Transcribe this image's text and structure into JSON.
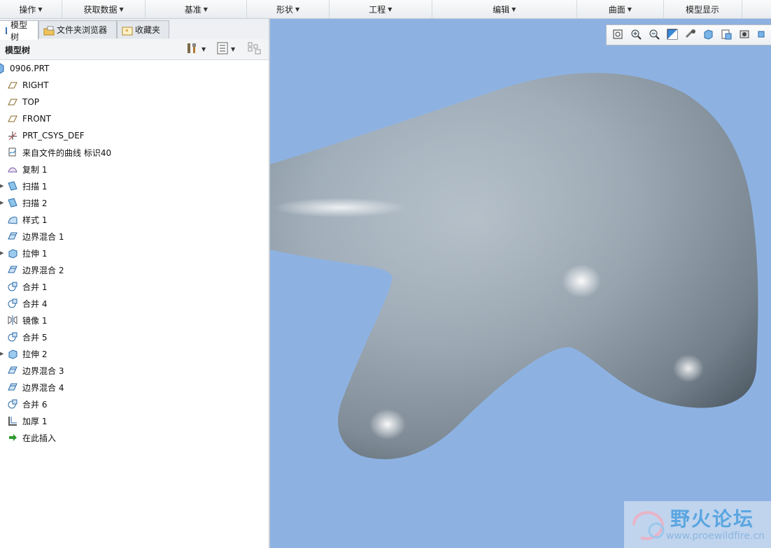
{
  "menubar": {
    "groups": [
      {
        "label": "操作"
      },
      {
        "label": "获取数据"
      },
      {
        "label": "基准"
      },
      {
        "label": "形状"
      },
      {
        "label": "工程"
      },
      {
        "label": "编辑"
      },
      {
        "label": "曲面"
      },
      {
        "label": "模型显示"
      }
    ]
  },
  "tabs": [
    {
      "label": "模型树",
      "icon": "model-tree-icon"
    },
    {
      "label": "文件夹浏览器",
      "icon": "folder-browser-icon"
    },
    {
      "label": "收藏夹",
      "icon": "favorites-icon"
    }
  ],
  "tree_header": {
    "title": "模型树"
  },
  "tree": [
    {
      "label": "0906.PRT",
      "icon": "part-icon",
      "expandable": false
    },
    {
      "label": "RIGHT",
      "icon": "datum-plane-icon",
      "expandable": false
    },
    {
      "label": "TOP",
      "icon": "datum-plane-icon",
      "expandable": false
    },
    {
      "label": "FRONT",
      "icon": "datum-plane-icon",
      "expandable": false
    },
    {
      "label": "PRT_CSYS_DEF",
      "icon": "csys-icon",
      "expandable": false
    },
    {
      "label": "来自文件的曲线 标识40",
      "icon": "curve-from-file-icon",
      "expandable": false
    },
    {
      "label": "复制 1",
      "icon": "copy-surface-icon",
      "expandable": false
    },
    {
      "label": "扫描 1",
      "icon": "sweep-icon",
      "expandable": true
    },
    {
      "label": "扫描 2",
      "icon": "sweep-icon",
      "expandable": true
    },
    {
      "label": "样式 1",
      "icon": "style-icon",
      "expandable": false
    },
    {
      "label": "边界混合 1",
      "icon": "boundary-blend-icon",
      "expandable": false
    },
    {
      "label": "拉伸 1",
      "icon": "extrude-icon",
      "expandable": true
    },
    {
      "label": "边界混合 2",
      "icon": "boundary-blend-icon",
      "expandable": false
    },
    {
      "label": "合并 1",
      "icon": "merge-icon",
      "expandable": false
    },
    {
      "label": "合并 4",
      "icon": "merge-icon",
      "expandable": false
    },
    {
      "label": "镜像 1",
      "icon": "mirror-icon",
      "expandable": false
    },
    {
      "label": "合并 5",
      "icon": "merge-icon",
      "expandable": false
    },
    {
      "label": "拉伸 2",
      "icon": "extrude-icon",
      "expandable": true
    },
    {
      "label": "边界混合 3",
      "icon": "boundary-blend-icon",
      "expandable": false
    },
    {
      "label": "边界混合 4",
      "icon": "boundary-blend-icon",
      "expandable": false
    },
    {
      "label": "合并 6",
      "icon": "merge-icon",
      "expandable": false
    },
    {
      "label": "加厚 1",
      "icon": "thicken-icon",
      "expandable": false
    },
    {
      "label": "在此插入",
      "icon": "insert-here-arrow-icon",
      "expandable": false
    }
  ],
  "view_toolbar": [
    {
      "icon": "refit-icon"
    },
    {
      "icon": "zoom-in-icon"
    },
    {
      "icon": "zoom-out-icon"
    },
    {
      "icon": "repaint-icon"
    },
    {
      "icon": "spin-center-icon"
    },
    {
      "icon": "display-style-icon"
    },
    {
      "icon": "saved-views-icon"
    },
    {
      "icon": "view-manager-icon"
    },
    {
      "icon": "perspective-icon"
    }
  ],
  "watermark": {
    "title": "野火论坛",
    "url": "www.proewildfire.cn"
  },
  "colors": {
    "viewport_bg": "#8db2e2",
    "model_surface": "#9aa9b5"
  }
}
